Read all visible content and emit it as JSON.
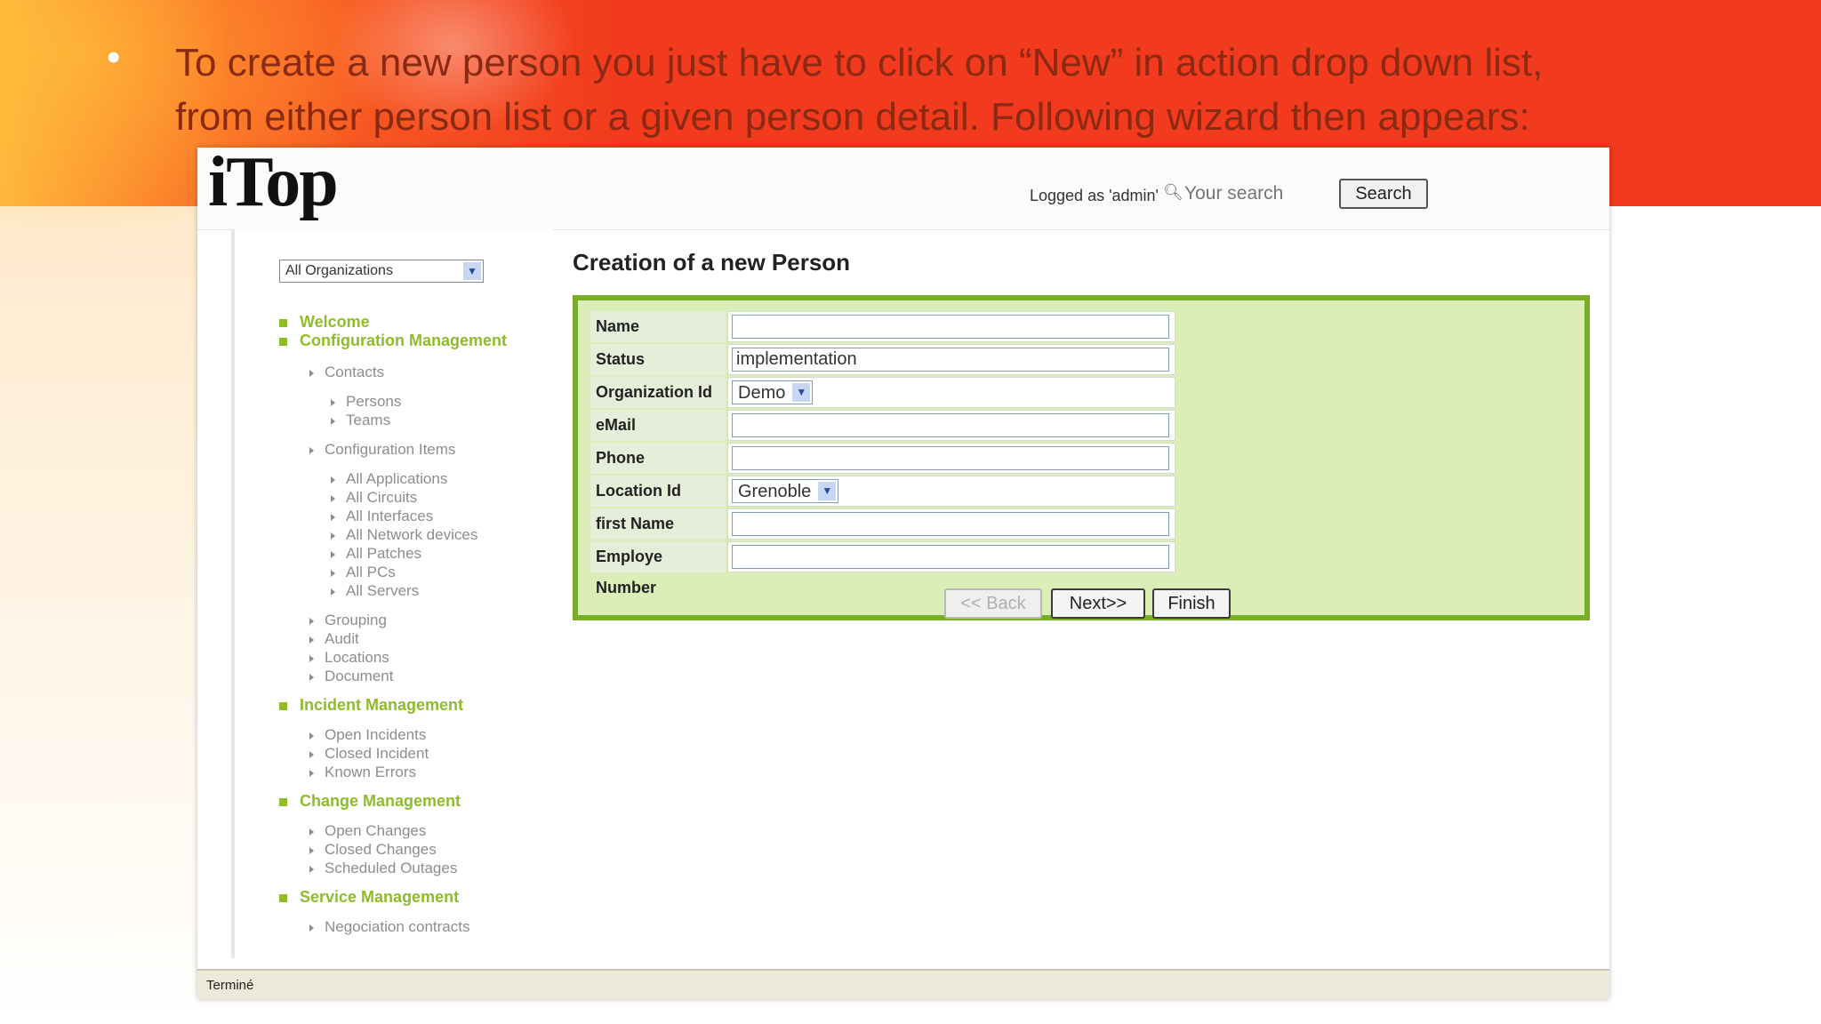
{
  "slide": {
    "bullet_line1": "To create a new person you just have to click on “New” in action drop down list,",
    "bullet_line2": "from either person list or a given person detail. Following wizard then appears:",
    "bullet_char": "•"
  },
  "header": {
    "logo": "iTop",
    "logged_as": "Logged as 'admin'",
    "search_placeholder": "Your search",
    "search_button": "Search"
  },
  "sidebar": {
    "org_select": "All Organizations",
    "sections": [
      {
        "label": "Welcome"
      },
      {
        "label": "Configuration Management"
      },
      {
        "label": "Incident Management"
      },
      {
        "label": "Change Management"
      },
      {
        "label": "Service Management"
      }
    ],
    "config_items": {
      "contacts": "Contacts",
      "persons": "Persons",
      "teams": "Teams",
      "configuration_items": "Configuration Items",
      "all_applications": "All Applications",
      "all_circuits": "All Circuits",
      "all_interfaces": "All Interfaces",
      "all_network_devices": "All Network devices",
      "all_patches": "All Patches",
      "all_pcs": "All PCs",
      "all_servers": "All Servers",
      "grouping": "Grouping",
      "audit": "Audit",
      "locations": "Locations",
      "document": "Document"
    },
    "incident_items": [
      "Open Incidents",
      "Closed Incident",
      "Known Errors"
    ],
    "change_items": [
      "Open Changes",
      "Closed Changes",
      "Scheduled Outages"
    ],
    "service_items": [
      "Negociation contracts"
    ]
  },
  "main": {
    "title": "Creation of a new Person",
    "fields": {
      "name": {
        "label": "Name",
        "value": ""
      },
      "status": {
        "label": "Status",
        "value": "implementation"
      },
      "organization": {
        "label": "Organization Id",
        "value": "Demo"
      },
      "email": {
        "label": "eMail",
        "value": ""
      },
      "phone": {
        "label": "Phone",
        "value": ""
      },
      "location": {
        "label": "Location Id",
        "value": "Grenoble"
      },
      "first_name": {
        "label": "first Name",
        "value": ""
      },
      "employee_number": {
        "label": "Employe Number",
        "value": ""
      }
    },
    "buttons": {
      "back": "<< Back",
      "next": "Next>>",
      "finish": "Finish"
    }
  },
  "statusbar": {
    "text": "Terminé"
  },
  "colors": {
    "accent_green": "#78ad26",
    "menu_green": "#8fbc2a",
    "panel_bg": "#dbeeb8",
    "slide_red": "#f23a1e",
    "text_dark_red": "#8a2a12"
  }
}
